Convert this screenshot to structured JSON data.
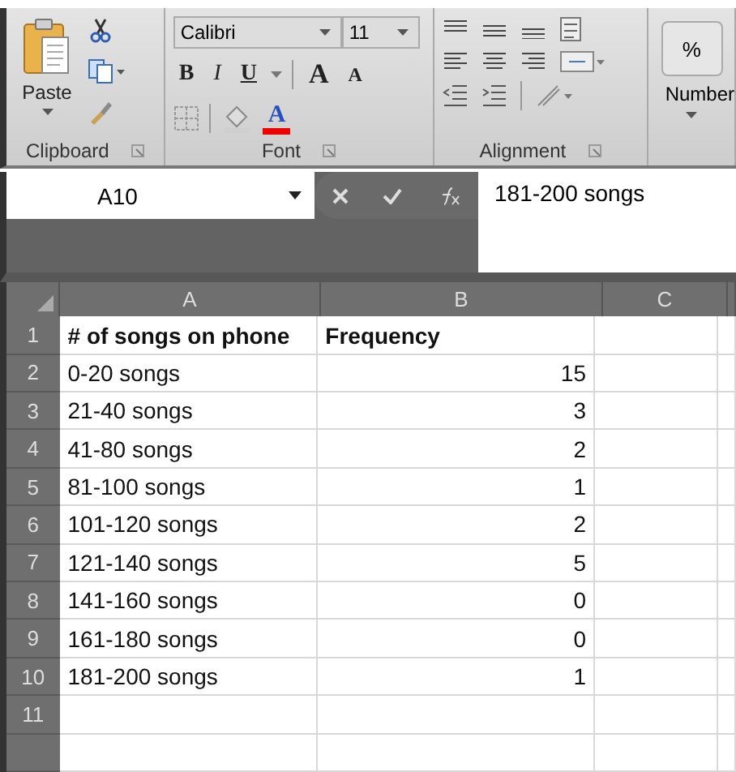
{
  "ribbon": {
    "clipboard": {
      "paste_label": "Paste",
      "group_label": "Clipboard"
    },
    "font": {
      "name": "Calibri",
      "size": "11",
      "bold": "B",
      "italic": "I",
      "underline": "U",
      "grow": "A",
      "shrink": "A",
      "color_letter": "A",
      "group_label": "Font"
    },
    "alignment": {
      "group_label": "Alignment"
    },
    "number": {
      "symbol": "%",
      "label": "Number"
    }
  },
  "formula_bar": {
    "name_box": "A10",
    "value": "181-200 songs"
  },
  "sheet": {
    "columns": [
      "A",
      "B",
      "C"
    ],
    "rows": [
      {
        "number": "1",
        "cells": [
          {
            "text": "# of songs on phone",
            "kind": "header"
          },
          {
            "text": "Frequency",
            "kind": "header"
          }
        ]
      },
      {
        "number": "2",
        "cells": [
          {
            "text": "0-20 songs",
            "kind": "text"
          },
          {
            "text": "15",
            "kind": "number"
          }
        ]
      },
      {
        "number": "3",
        "cells": [
          {
            "text": "21-40 songs",
            "kind": "text"
          },
          {
            "text": "3",
            "kind": "number"
          }
        ]
      },
      {
        "number": "4",
        "cells": [
          {
            "text": "41-80 songs",
            "kind": "text"
          },
          {
            "text": "2",
            "kind": "number"
          }
        ]
      },
      {
        "number": "5",
        "cells": [
          {
            "text": "81-100 songs",
            "kind": "text"
          },
          {
            "text": "1",
            "kind": "number"
          }
        ]
      },
      {
        "number": "6",
        "cells": [
          {
            "text": "101-120 songs",
            "kind": "text"
          },
          {
            "text": "2",
            "kind": "number"
          }
        ]
      },
      {
        "number": "7",
        "cells": [
          {
            "text": "121-140 songs",
            "kind": "text"
          },
          {
            "text": "5",
            "kind": "number"
          }
        ]
      },
      {
        "number": "8",
        "cells": [
          {
            "text": "141-160 songs",
            "kind": "text"
          },
          {
            "text": "0",
            "kind": "number"
          }
        ]
      },
      {
        "number": "9",
        "cells": [
          {
            "text": "161-180 songs",
            "kind": "text"
          },
          {
            "text": "0",
            "kind": "number"
          }
        ]
      },
      {
        "number": "10",
        "cells": [
          {
            "text": "181-200 songs",
            "kind": "text"
          },
          {
            "text": "1",
            "kind": "number"
          }
        ]
      },
      {
        "number": "11",
        "cells": []
      }
    ]
  }
}
